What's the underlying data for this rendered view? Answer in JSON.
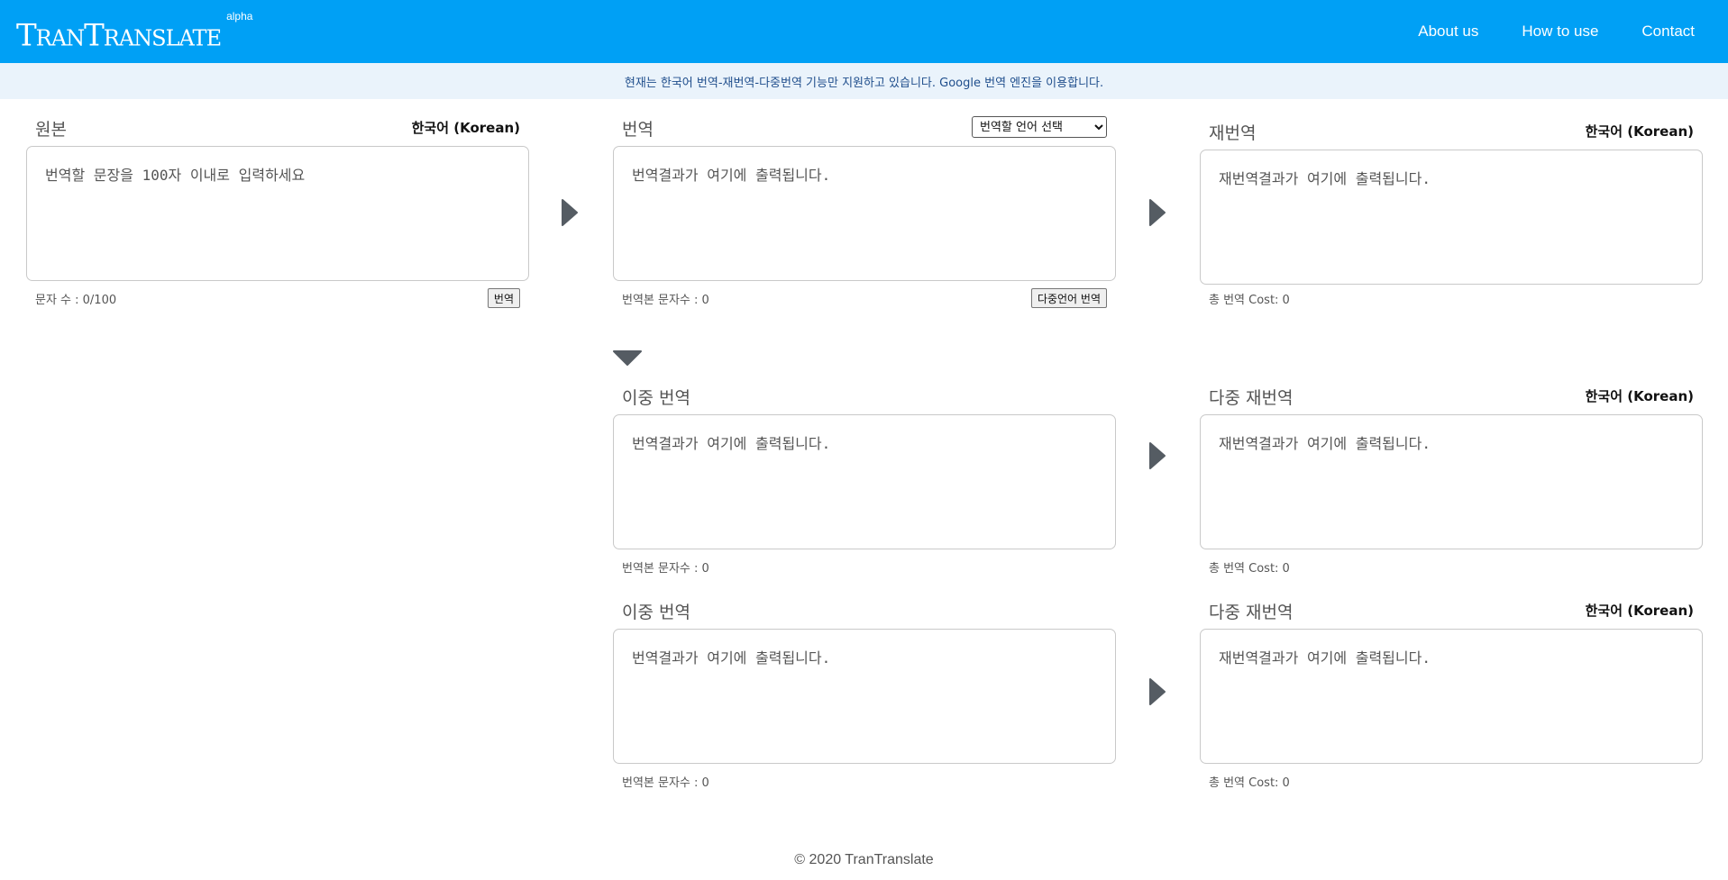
{
  "app": {
    "logo": "TranTranslate",
    "logo_sup": "alpha"
  },
  "nav": {
    "about": "About us",
    "how": "How to use",
    "contact": "Contact"
  },
  "notice": "현재는 한국어 번역-재번역-다중번역 기능만 지원하고 있습니다. Google 번역 엔진을 이용합니다.",
  "source": {
    "title": "원본",
    "lang": "한국어 (Korean)",
    "placeholder": "번역할 문장을 100자 이내로 입력하세요",
    "count": "문자 수 : 0/100",
    "button": "번역"
  },
  "translation": {
    "title": "번역",
    "select": "번역할 언어 선택",
    "placeholder": "번역결과가 여기에 출력됩니다.",
    "count": "번역본 문자수 : 0",
    "button": "다중언어 번역"
  },
  "retranslation": {
    "title": "재번역",
    "lang": "한국어 (Korean)",
    "placeholder": "재번역결과가 여기에 출력됩니다.",
    "cost": "총 번역 Cost: 0"
  },
  "double_rows": [
    {
      "left_title": "이중 번역",
      "left_placeholder": "번역결과가 여기에 출력됩니다.",
      "left_count": "번역본 문자수 : 0",
      "right_title": "다중 재번역",
      "right_lang": "한국어 (Korean)",
      "right_placeholder": "재번역결과가 여기에 출력됩니다.",
      "right_cost": "총 번역 Cost: 0"
    },
    {
      "left_title": "이중 번역",
      "left_placeholder": "번역결과가 여기에 출력됩니다.",
      "left_count": "번역본 문자수 : 0",
      "right_title": "다중 재번역",
      "right_lang": "한국어 (Korean)",
      "right_placeholder": "재번역결과가 여기에 출력됩니다.",
      "right_cost": "총 번역 Cost: 0"
    }
  ],
  "footer": "© 2020 TranTranslate",
  "icons": {
    "arrow": "caret-right-icon",
    "expand": "caret-down-icon"
  },
  "colors": {
    "header": "#00a0f5",
    "notice_bg": "#eaf3fb",
    "arrow": "#555c63"
  }
}
